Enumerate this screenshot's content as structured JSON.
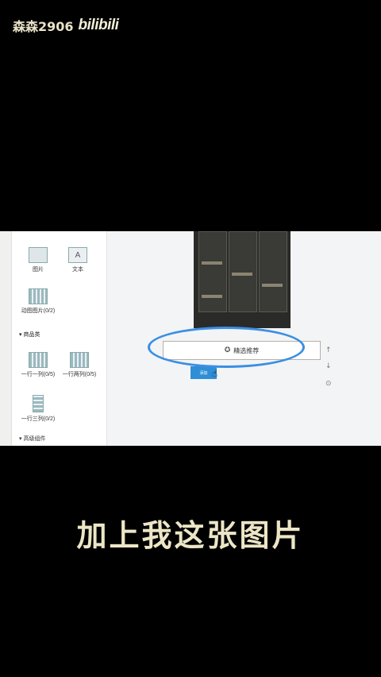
{
  "watermark": {
    "user": "森森2906",
    "brand": "bilibili"
  },
  "sidebar": {
    "tiles": [
      {
        "label": "图片",
        "icon": "image-icon"
      },
      {
        "label": "文本",
        "icon": "text-icon"
      },
      {
        "label": "动图图片(0/2)",
        "icon": "gif-icon"
      }
    ],
    "section_goods": "▾ 商品类",
    "goods_tiles": [
      {
        "label": "一行一列(0/5)",
        "icon": "grid-one-icon"
      },
      {
        "label": "一行两列(0/5)",
        "icon": "grid-two-icon"
      },
      {
        "label": "一行三列(0/2)",
        "icon": "grid-three-icon"
      }
    ],
    "section_advanced": "▾ 高级组件"
  },
  "canvas": {
    "featured_label": "精选推荐",
    "featured_icon": "star-badge-icon",
    "add_button_label": "添加",
    "tools": [
      "↑",
      "↓",
      "⊙"
    ]
  },
  "caption": "加上我这张图片",
  "colors": {
    "accent": "#2f8ed6",
    "highlight_ring": "#3b8fe3",
    "caption": "#ece6c6"
  }
}
